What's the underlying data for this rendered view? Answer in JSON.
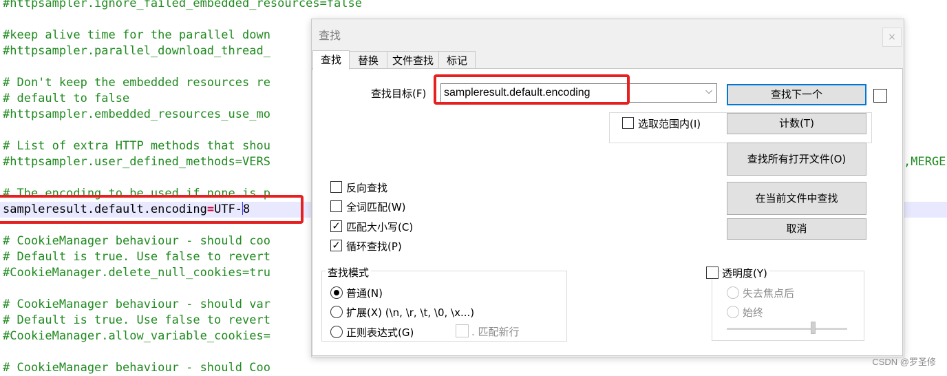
{
  "editor": {
    "lines": [
      "#httpsampler.ignore_failed_embedded_resources=false",
      "#keep alive time for the parallel down",
      "#httpsampler.parallel_download_thread_",
      "# Don't keep the embedded resources re",
      "# default to false",
      "#httpsampler.embedded_resources_use_mo",
      "# List of extra HTTP methods that shou",
      "#httpsampler.user_defined_methods=VERS",
      "# The encoding to be used if none is p",
      "# CookieManager behaviour - should coo",
      "# Default is true. Use false to revert",
      "#CookieManager.delete_null_cookies=tru",
      "# CookieManager behaviour - should var",
      "# Default is true. Use false to revert",
      "#CookieManager.allow_variable_cookies=",
      "# CookieManager behaviour - should Coo"
    ],
    "current_line": {
      "key": "sampleresult.default.encoding",
      "eq": "=",
      "value_before_caret": "UTF-",
      "value_after_caret": "8"
    },
    "overflow_text": ",MERGE"
  },
  "dialog": {
    "title": "查找",
    "close_label": "×",
    "tabs": [
      {
        "label": "查找"
      },
      {
        "label": "替换"
      },
      {
        "label": "文件查找"
      },
      {
        "label": "标记"
      }
    ],
    "find_label": "查找目标(F)",
    "find_value": "sampleresult.default.encoding",
    "combo_arrow": "⌵",
    "in_selection": "选取范围内(I)",
    "buttons": {
      "find_next": "查找下一个",
      "count": "计数(T)",
      "find_all_open": "查找所有打开文件(O)",
      "find_in_current": "在当前文件中查找",
      "cancel": "取消"
    },
    "options": {
      "backward": {
        "label": "反向查找",
        "checked": false
      },
      "whole_word": {
        "label": "全词匹配(W)",
        "checked": false
      },
      "match_case": {
        "label": "匹配大小写(C)",
        "checked": true
      },
      "wrap": {
        "label": "循环查找(P)",
        "checked": true
      }
    },
    "search_mode": {
      "title": "查找模式",
      "normal": "普通(N)",
      "extended": "扩展(X) (\\n, \\r, \\t, \\0, \\x...)",
      "regex": "正则表达式(G)",
      "dot_newline": ". 匹配新行",
      "selected": "normal"
    },
    "transparency": {
      "label": "透明度(Y)",
      "on_lose_focus": "失去焦点后",
      "always": "始终",
      "level": 0.7
    },
    "check_mark": "✓"
  },
  "watermark": "CSDN @罗圣修"
}
